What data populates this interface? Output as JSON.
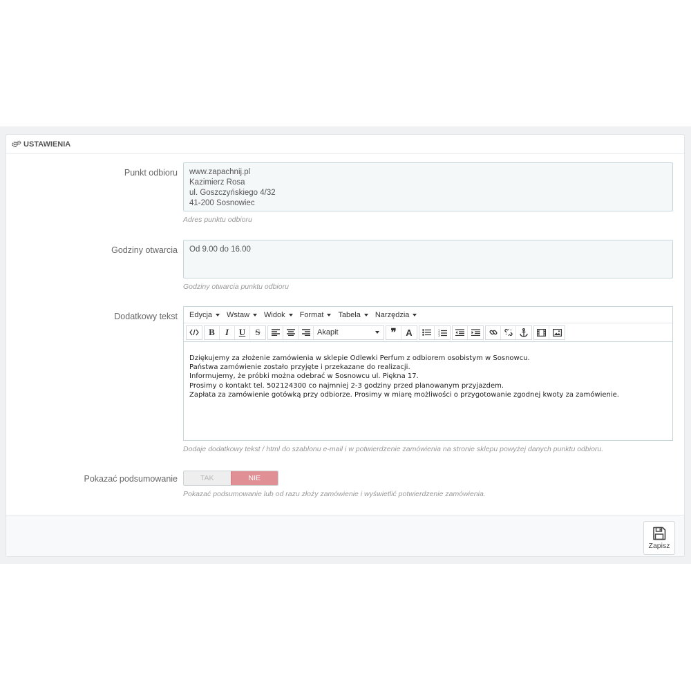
{
  "panel": {
    "heading": "Ustawienia",
    "heading_icon": "gears-icon"
  },
  "pickup": {
    "label": "Punkt odbioru",
    "value_lines": [
      "www.zapachnij.pl",
      "Kazimierz Rosa",
      "ul. Goszczyńskiego 4/32",
      "41-200 Sosnowiec"
    ],
    "help": "Adres punktu odbioru"
  },
  "hours": {
    "label": "Godziny otwarcia",
    "value": "Od 9.00 do 16.00",
    "help": "Godziny otwarcia punktu odbioru"
  },
  "extra_text": {
    "label": "Dodatkowy tekst",
    "menus": [
      "Edycja",
      "Wstaw",
      "Widok",
      "Format",
      "Tabela",
      "Narzędzia"
    ],
    "format_select": "Akapit",
    "toolbar_icons": [
      "source-code-icon",
      "bold-icon",
      "italic-icon",
      "underline-icon",
      "strikethrough-icon",
      "align-left-icon",
      "align-center-icon",
      "align-right-icon",
      "blockquote-icon",
      "text-color-icon",
      "bullet-list-icon",
      "numbered-list-icon",
      "outdent-icon",
      "indent-icon",
      "link-icon",
      "unlink-icon",
      "anchor-icon",
      "media-icon",
      "image-icon"
    ],
    "content_lines": [
      "Dziękujemy za złożenie zamówienia w sklepie Odlewki Perfum z odbiorem osobistym w Sosnowcu.",
      "Państwa zamówienie zostało przyjęte i przekazane do realizacji.",
      "Informujemy, że próbki można odebrać w Sosnowcu ul. Piękna 17.",
      "Prosimy o kontakt tel. 502124300 co najmniej 2-3 godziny przed planowanym przyjazdem.",
      "Zapłata za zamówienie gotówką przy odbiorze. Prosimy w miarę możliwości o przygotowanie zgodnej kwoty za zamówienie."
    ],
    "help": "Dodaje dodatkowy tekst / html do szablonu e-mail i w potwierdzenie zamówienia na stronie sklepu powyżej danych punktu odbioru."
  },
  "summary": {
    "label": "Pokazać podsumowanie",
    "yes": "TAK",
    "no": "NIE",
    "selected": "NIE",
    "help": "Pokazać podsumowanie lub od razu złoży zamówienie i wyświetlić potwierdzenie zamówienia.",
    "active_color": "#e08f95"
  },
  "footer": {
    "save_label": "Zapisz",
    "save_icon": "save-icon"
  }
}
